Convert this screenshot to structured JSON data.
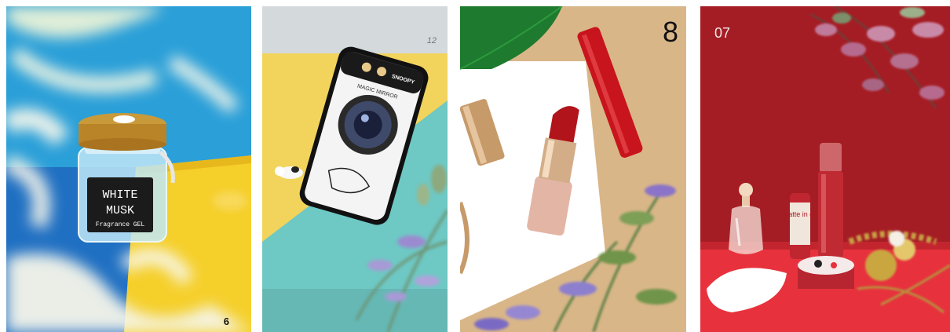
{
  "tiles": [
    {
      "number": "6",
      "subject": "white-musk-jar",
      "label_line1": "WHITE",
      "label_line2": "MUSK",
      "label_line3": "Fragrance GEL"
    },
    {
      "number": "12",
      "subject": "camera-phone-case",
      "ring_text": "MAGIC MIRROR",
      "brand_text": "SNOOPY"
    },
    {
      "number": "8",
      "subject": "red-lipsticks"
    },
    {
      "number": "07",
      "subject": "red-cosmetics-display",
      "bottle_text": "matte in go"
    }
  ]
}
